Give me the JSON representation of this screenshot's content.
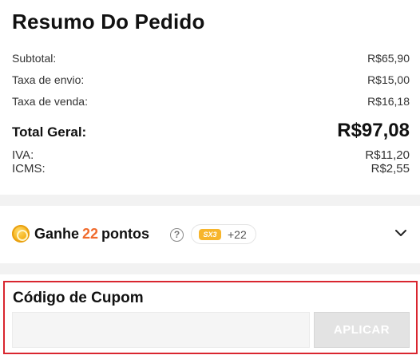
{
  "summary": {
    "title": "Resumo Do Pedido",
    "rows": [
      {
        "label": "Subtotal:",
        "value": "R$65,90"
      },
      {
        "label": "Taxa de envio:",
        "value": "R$15,00"
      },
      {
        "label": "Taxa de venda:",
        "value": "R$16,18"
      }
    ],
    "total": {
      "label": "Total Geral:",
      "value": "R$97,08"
    },
    "taxes": [
      {
        "label": "IVA:",
        "value": "R$11,20"
      },
      {
        "label": "ICMS:",
        "value": "R$2,55"
      }
    ]
  },
  "points": {
    "prefix": "Ganhe",
    "amount": "22",
    "suffix": "pontos",
    "help_icon": "?",
    "badge_text": "SX3",
    "bonus": "+22",
    "accent_color": "#f06a2c"
  },
  "coupon": {
    "title": "Código de Cupom",
    "input_value": "",
    "input_placeholder": "",
    "apply_label": "APLICAR",
    "border_color": "#d9262f"
  }
}
